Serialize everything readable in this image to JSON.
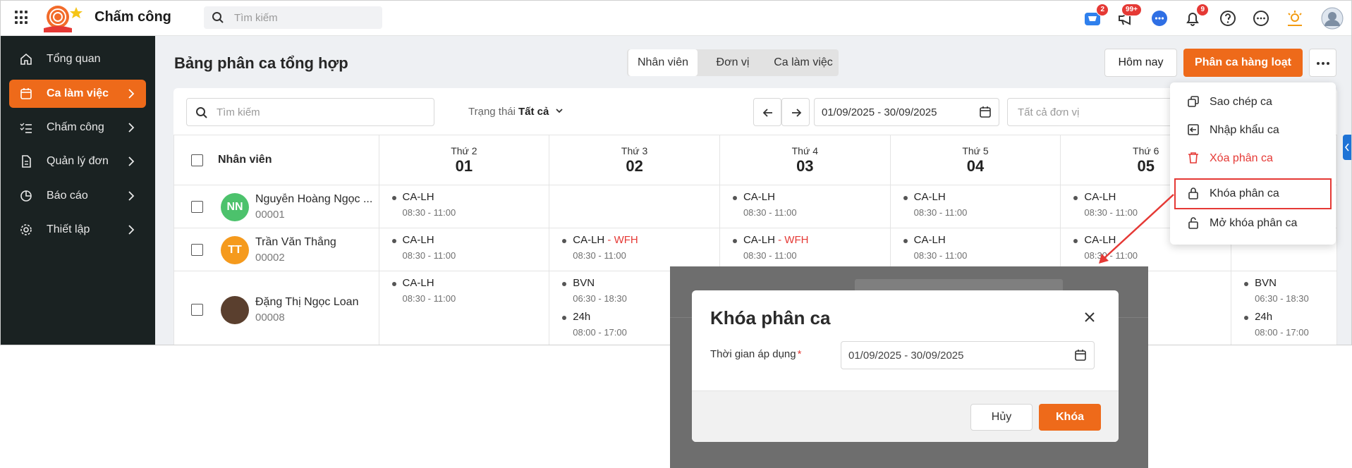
{
  "app": {
    "title": "Chấm công",
    "search_placeholder": "Tìm kiếm",
    "badges": {
      "cart": "2",
      "megaphone": "99+",
      "bell": "9"
    }
  },
  "sidebar": {
    "items": [
      {
        "label": "Tổng quan",
        "icon": "home-icon",
        "active": false,
        "has_children": false
      },
      {
        "label": "Ca làm việc",
        "icon": "calendar-icon",
        "active": true,
        "has_children": true
      },
      {
        "label": "Chấm công",
        "icon": "checklist-icon",
        "active": false,
        "has_children": true
      },
      {
        "label": "Quản lý đơn",
        "icon": "document-icon",
        "active": false,
        "has_children": true
      },
      {
        "label": "Báo cáo",
        "icon": "pie-chart-icon",
        "active": false,
        "has_children": true
      },
      {
        "label": "Thiết lập",
        "icon": "gear-icon",
        "active": false,
        "has_children": true
      }
    ]
  },
  "page": {
    "title": "Bảng phân ca tổng hợp",
    "view_tabs": [
      "Nhân viên",
      "Đơn vị",
      "Ca làm việc"
    ],
    "active_view_tab": 0,
    "today_button": "Hôm nay",
    "bulk_button": "Phân ca hàng loạt"
  },
  "filters": {
    "search_placeholder": "Tìm kiếm",
    "status_label": "Trạng thái",
    "status_value": "Tất cả",
    "date_range": "01/09/2025 - 30/09/2025",
    "unit_placeholder": "Tất cả đơn vị"
  },
  "table": {
    "employee_header": "Nhân viên",
    "days": [
      {
        "name": "Thứ 2",
        "date": "01"
      },
      {
        "name": "Thứ 3",
        "date": "02"
      },
      {
        "name": "Thứ 4",
        "date": "03"
      },
      {
        "name": "Thứ 5",
        "date": "04"
      },
      {
        "name": "Thứ 6",
        "date": "05"
      }
    ],
    "rows": [
      {
        "initials": "NN",
        "avatar_color": "#4cc26c",
        "name": "Nguyễn Hoàng Ngọc ...",
        "code": "00001",
        "cells": [
          [
            {
              "name": "CA-LH",
              "tag": "",
              "time": "08:30 - 11:00"
            }
          ],
          [],
          [
            {
              "name": "CA-LH",
              "tag": "",
              "time": "08:30 - 11:00"
            }
          ],
          [
            {
              "name": "CA-LH",
              "tag": "",
              "time": "08:30 - 11:00"
            }
          ],
          [
            {
              "name": "CA-LH",
              "tag": "",
              "time": "08:30 - 11:00"
            }
          ],
          []
        ]
      },
      {
        "initials": "TT",
        "avatar_color": "#f59a1d",
        "name": "Trần Văn Thắng",
        "code": "00002",
        "cells": [
          [
            {
              "name": "CA-LH",
              "tag": "",
              "time": "08:30 - 11:00"
            }
          ],
          [
            {
              "name": "CA-LH",
              "tag": " - WFH",
              "time": "08:30 - 11:00"
            }
          ],
          [
            {
              "name": "CA-LH",
              "tag": " - WFH",
              "time": "08:30 - 11:00"
            }
          ],
          [
            {
              "name": "CA-LH",
              "tag": "",
              "time": "08:30 - 11:00"
            }
          ],
          [
            {
              "name": "CA-LH",
              "tag": "",
              "time": "08:30 - 11:00"
            }
          ],
          []
        ]
      },
      {
        "initials": "",
        "avatar_color": "#5a3f2e",
        "name": "Đặng Thị Ngọc Loan",
        "code": "00008",
        "cells": [
          [
            {
              "name": "CA-LH",
              "tag": "",
              "time": "08:30 - 11:00"
            }
          ],
          [
            {
              "name": "BVN",
              "tag": "",
              "time": "06:30 - 18:30"
            },
            {
              "name": "24h",
              "tag": "",
              "time": "08:00 - 17:00"
            }
          ],
          [],
          [],
          [],
          [
            {
              "name": "BVN",
              "tag": "",
              "time": "06:30 - 18:30"
            },
            {
              "name": "24h",
              "tag": "",
              "time": "08:00 - 17:00"
            }
          ]
        ]
      }
    ]
  },
  "menu": {
    "items": [
      {
        "label": "Sao chép ca",
        "icon": "copy-icon",
        "danger": false,
        "highlighted": false
      },
      {
        "label": "Nhập khẩu ca",
        "icon": "import-icon",
        "danger": false,
        "highlighted": false
      },
      {
        "label": "Xóa phân ca",
        "icon": "trash-icon",
        "danger": true,
        "highlighted": false
      },
      {
        "label": "Khóa phân ca",
        "icon": "lock-icon",
        "danger": false,
        "highlighted": true
      },
      {
        "label": "Mở khóa phân ca",
        "icon": "unlock-icon",
        "danger": false,
        "highlighted": false
      }
    ]
  },
  "dialog": {
    "title": "Khóa phân ca",
    "field_label": "Thời gian áp dụng",
    "required_mark": "*",
    "date_value": "01/09/2025 - 30/09/2025",
    "cancel_label": "Hủy",
    "confirm_label": "Khóa"
  },
  "colors": {
    "accent": "#ee6a1a",
    "sidebar_bg": "#1a2222",
    "danger": "#e53935",
    "annotation": "#e53935"
  }
}
